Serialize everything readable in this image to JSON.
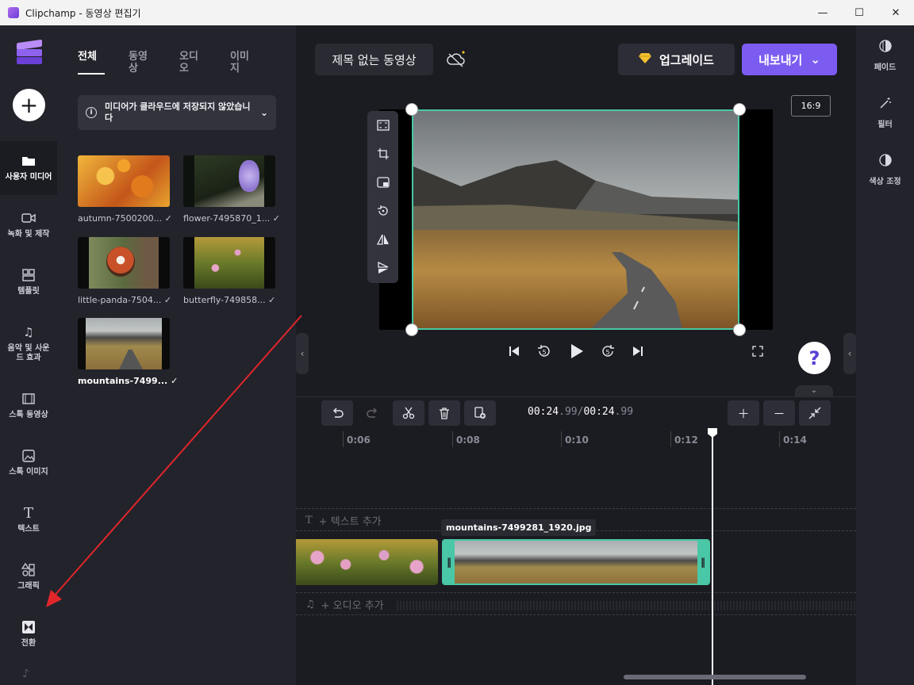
{
  "window": {
    "title": "Clipchamp - 동영상 편집기",
    "minimize": "—",
    "maximize": "☐",
    "close": "✕"
  },
  "nav": {
    "items": [
      {
        "label": "사용자 미디어",
        "icon": "folder-icon"
      },
      {
        "label": "녹화 및 제작",
        "icon": "video-camera-icon"
      },
      {
        "label": "템플릿",
        "icon": "templates-icon"
      },
      {
        "label": "음악 및 사운\n드 효과",
        "icon": "music-note-icon"
      },
      {
        "label": "스톡 동영상",
        "icon": "film-icon"
      },
      {
        "label": "스톡 이미지",
        "icon": "image-icon"
      },
      {
        "label": "텍스트",
        "icon": "text-icon"
      },
      {
        "label": "그래픽",
        "icon": "shapes-icon"
      },
      {
        "label": "전환",
        "icon": "transition-icon"
      }
    ]
  },
  "media": {
    "tabs": [
      "전체",
      "동영상",
      "오디오",
      "이미지"
    ],
    "active_tab": "전체",
    "cloud_notice": "미디어가 클라우드에 저장되지 않았습니다",
    "items": [
      {
        "name": "autumn-7500200...",
        "checked": true
      },
      {
        "name": "flower-7495870_1...",
        "checked": true
      },
      {
        "name": "little-panda-7504...",
        "checked": true
      },
      {
        "name": "butterfly-749858...",
        "checked": true
      },
      {
        "name": "mountains-7499...",
        "checked": true
      }
    ],
    "check_mark": "✓"
  },
  "header": {
    "project_title": "제목 없는 동영상",
    "upgrade_label": "업그레이드",
    "export_label": "내보내기"
  },
  "preview": {
    "aspect_ratio": "16:9"
  },
  "right_panel": {
    "items": [
      {
        "label": "페이드",
        "icon": "fade-icon"
      },
      {
        "label": "필터",
        "icon": "magic-wand-icon"
      },
      {
        "label": "색상 조정",
        "icon": "contrast-icon"
      }
    ]
  },
  "timeline": {
    "time_current": "00:24",
    "time_current_frac": ".99",
    "time_sep": "/",
    "time_total": "00:24",
    "time_total_frac": ".99",
    "ruler": [
      "0:06",
      "0:08",
      "0:10",
      "0:12",
      "0:14"
    ],
    "text_track_hint": "+ 텍스트 추가",
    "audio_track_hint": "+ 오디오 추가",
    "selected_clip_name": "mountains-7499281_1920.jpg"
  },
  "help": "?",
  "colors": {
    "accent": "#7c5cf0",
    "selection": "#49c7a6",
    "annotation_arrow": "#e0262b"
  }
}
